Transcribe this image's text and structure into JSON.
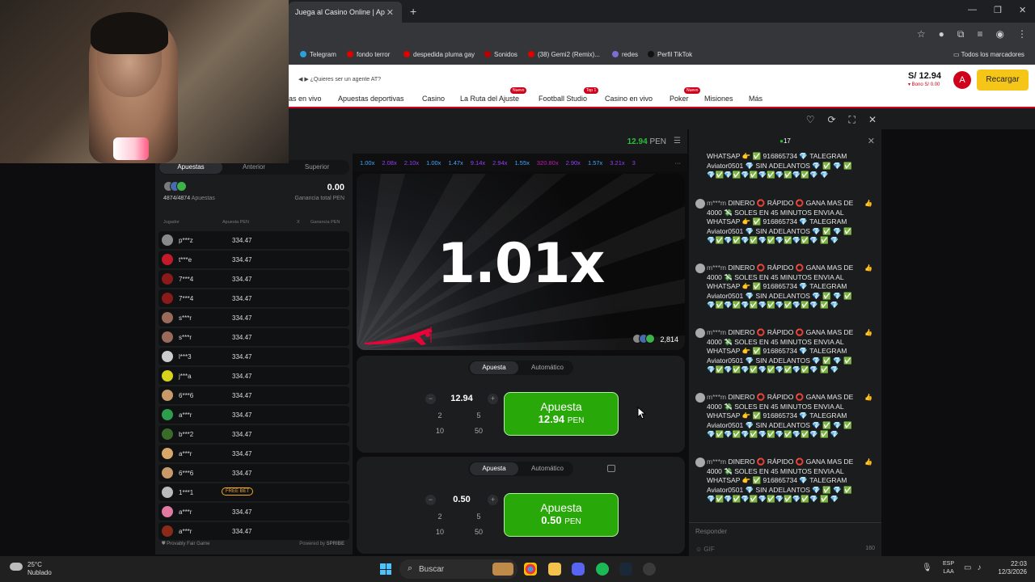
{
  "browser": {
    "tab_title": "Juega al Casino Online | Ap",
    "bookmarks": [
      {
        "label": "Telegram",
        "color": "#2aa1da"
      },
      {
        "label": "fondo terror",
        "color": "#e00000"
      },
      {
        "label": "despedida pluma gay",
        "color": "#e00000"
      },
      {
        "label": "Sonidos",
        "color": "#b80000"
      },
      {
        "label": "(38) Gemi2 (Remix)...",
        "color": "#e00000"
      },
      {
        "label": "redes",
        "color": "#7a6fd0"
      },
      {
        "label": "Perfil TikTok",
        "color": "#111111"
      }
    ],
    "all_bookmarks": "Todos los marcadores"
  },
  "site": {
    "agent_link": "¿Quieres ser un agente AT?",
    "nav": [
      {
        "label": "as en vivo",
        "badge": ""
      },
      {
        "label": "Apuestas deportivas",
        "badge": ""
      },
      {
        "label": "Casino",
        "badge": ""
      },
      {
        "label": "La Ruta del Ajuste",
        "badge": "Nuevo"
      },
      {
        "label": "Football Studio",
        "badge": "Top 1"
      },
      {
        "label": "Casino en vivo",
        "badge": ""
      },
      {
        "label": "Poker",
        "badge": "Nuevo"
      },
      {
        "label": "Misiones",
        "badge": ""
      },
      {
        "label": "Más",
        "badge": ""
      }
    ],
    "balance": "S/ 12.94",
    "bonus": "▾ Bono S/ 0.00",
    "avatar_letter": "A",
    "recargar": "Recargar",
    "accent": "#d0021b"
  },
  "game": {
    "balance_value": "12.94",
    "balance_currency": "PEN",
    "multiplier_history": [
      {
        "v": "1.00x",
        "c": "#3fa7ff"
      },
      {
        "v": "2.08x",
        "c": "#913ef8"
      },
      {
        "v": "2.10x",
        "c": "#913ef8"
      },
      {
        "v": "1.00x",
        "c": "#3fa7ff"
      },
      {
        "v": "1.47x",
        "c": "#3fa7ff"
      },
      {
        "v": "9.14x",
        "c": "#913ef8"
      },
      {
        "v": "2.94x",
        "c": "#913ef8"
      },
      {
        "v": "1.55x",
        "c": "#3fa7ff"
      },
      {
        "v": "320.80x",
        "c": "#c017b4"
      },
      {
        "v": "2.90x",
        "c": "#913ef8"
      },
      {
        "v": "1.57x",
        "c": "#3fa7ff"
      },
      {
        "v": "3.21x",
        "c": "#913ef8"
      },
      {
        "v": "3",
        "c": "#913ef8"
      }
    ],
    "bets_tabs": [
      "Apuestas",
      "Anterior",
      "Superior"
    ],
    "bets_count": "4874/4874",
    "bets_count_label": "Apuestas",
    "total_win": "0.00",
    "total_win_label": "Ganancia total PEN",
    "col_player": "Jugador",
    "col_bet": "Apuesta PEN",
    "col_x": "X",
    "col_win": "Ganancia PEN",
    "bets": [
      {
        "user": "p***z",
        "amount": "334.47",
        "avatar": "#8a8a8a",
        "free": false
      },
      {
        "user": "t***e",
        "amount": "334.47",
        "avatar": "#c21a2a",
        "free": false
      },
      {
        "user": "7***4",
        "amount": "334.47",
        "avatar": "#8b1a1a",
        "free": false
      },
      {
        "user": "7***4",
        "amount": "334.47",
        "avatar": "#8b1a1a",
        "free": false
      },
      {
        "user": "s***r",
        "amount": "334.47",
        "avatar": "#9a6a5a",
        "free": false
      },
      {
        "user": "s***r",
        "amount": "334.47",
        "avatar": "#9a6a5a",
        "free": false
      },
      {
        "user": "l***3",
        "amount": "334.47",
        "avatar": "#cccccc",
        "free": false
      },
      {
        "user": "j***a",
        "amount": "334.47",
        "avatar": "#d8d21a",
        "free": false
      },
      {
        "user": "6***6",
        "amount": "334.47",
        "avatar": "#c89a6a",
        "free": false
      },
      {
        "user": "a***r",
        "amount": "334.47",
        "avatar": "#2e9e4e",
        "free": false
      },
      {
        "user": "b***2",
        "amount": "334.47",
        "avatar": "#3b6b2b",
        "free": false
      },
      {
        "user": "a***r",
        "amount": "334.47",
        "avatar": "#d8a86a",
        "free": false
      },
      {
        "user": "6***6",
        "amount": "334.47",
        "avatar": "#c89a6a",
        "free": false
      },
      {
        "user": "1***1",
        "amount": "FREE BET",
        "avatar": "#bbbbbb",
        "free": true
      },
      {
        "user": "a***r",
        "amount": "334.47",
        "avatar": "#e07aa0",
        "free": false
      },
      {
        "user": "a***r",
        "amount": "334.47",
        "avatar": "#8a2a1a",
        "free": false
      }
    ],
    "provably_fair": "Provably Fair Game",
    "powered_by": "Powered by",
    "spribe": "SPRIBE",
    "current_multiplier": "1.01x",
    "players_online": "2,814",
    "panels": [
      {
        "tab_bet": "Apuesta",
        "tab_auto": "Automático",
        "amount": "12.94",
        "quick": [
          "2",
          "5",
          "10",
          "50"
        ],
        "button_label": "Apuesta",
        "button_amount": "12.94",
        "button_currency": "PEN"
      },
      {
        "tab_bet": "Apuesta",
        "tab_auto": "Automático",
        "amount": "0.50",
        "quick": [
          "2",
          "5",
          "10",
          "50"
        ],
        "button_label": "Apuesta",
        "button_amount": "0.50",
        "button_currency": "PEN"
      }
    ],
    "bet_button_color": "#28a909"
  },
  "chat": {
    "online_count": "17",
    "messages": [
      {
        "user": "",
        "text": "WHATSAP 👉 ✅ 916865734 💎 TALEGRAM Aviator0501 💎 SIN ADELANTOS 💎 ✅ 💎 ✅ 💎✅💎✅💎✅💎✅💎✅💎✅💎 💎",
        "partial": true
      },
      {
        "user": "m***m",
        "text": "DINERO ⭕ RÁPIDO ⭕ GANA MAS DE 4000 💸 SOLES EN 45 MINUTOS ENVIA AL WHATSAP 👉 ✅ 916865734 💎 TALEGRAM Aviator0501 💎 SIN ADELANTOS 💎 ✅ 💎 ✅ 💎✅💎✅💎✅💎✅💎✅💎✅💎 ✅ 💎",
        "partial": false
      },
      {
        "user": "m***m",
        "text": "DINERO ⭕ RÁPIDO ⭕ GANA MAS DE 4000 💸 SOLES EN 45 MINUTOS ENVIA AL WHATSAP 👉 ✅ 916865734 💎 TALEGRAM Aviator0501 💎 SIN ADELANTOS 💎 ✅ 💎 ✅ 💎✅💎✅💎✅💎✅💎✅💎✅💎 ✅ 💎",
        "partial": false
      },
      {
        "user": "m***m",
        "text": "DINERO ⭕ RÁPIDO ⭕ GANA MAS DE 4000 💸 SOLES EN 45 MINUTOS ENVIA AL WHATSAP 👉 ✅ 916865734 💎 TALEGRAM Aviator0501 💎 SIN ADELANTOS 💎 ✅ 💎 ✅ 💎✅💎✅💎✅💎✅💎✅💎✅💎 ✅ 💎",
        "partial": false
      },
      {
        "user": "m***m",
        "text": "DINERO ⭕ RÁPIDO ⭕ GANA MAS DE 4000 💸 SOLES EN 45 MINUTOS ENVIA AL WHATSAP 👉 ✅ 916865734 💎 TALEGRAM Aviator0501 💎 SIN ADELANTOS 💎 ✅ 💎 ✅ 💎✅💎✅💎✅💎✅💎✅💎✅💎 ✅ 💎",
        "partial": false
      },
      {
        "user": "m***m",
        "text": "DINERO ⭕ RÁPIDO ⭕ GANA MAS DE 4000 💸 SOLES EN 45 MINUTOS ENVIA AL WHATSAP 👉 ✅ 916865734 💎 TALEGRAM Aviator0501 💎 SIN ADELANTOS 💎 ✅ 💎 ✅ 💎✅💎✅💎✅💎✅💎✅💎✅💎 ✅ 💎",
        "partial": false
      }
    ],
    "placeholder": "Responder",
    "char_limit": "160",
    "gif_label": "GIF"
  },
  "taskbar": {
    "temperature": "25°C",
    "weather": "Nublado",
    "search": "Buscar",
    "lang_1": "ESP",
    "lang_2": "LAA",
    "time": "22:03",
    "date": "12/3/2026"
  }
}
